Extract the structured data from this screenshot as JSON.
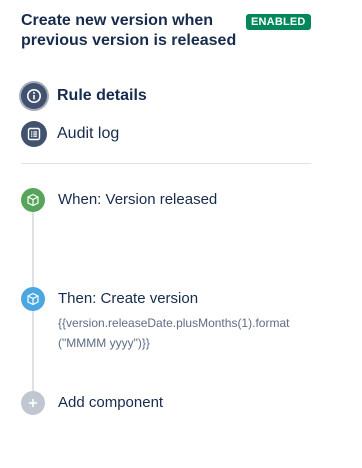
{
  "rule": {
    "title": "Create new version when previous version is released",
    "status_badge": "ENABLED"
  },
  "nav": {
    "items": [
      {
        "label": "Rule details",
        "icon": "info-icon",
        "active": true
      },
      {
        "label": "Audit log",
        "icon": "audit-log-icon",
        "active": false
      }
    ]
  },
  "components": {
    "trigger": {
      "label": "When: Version released",
      "icon": "trigger-cube-icon",
      "color": "#57a55a"
    },
    "action": {
      "label": "Then: Create version",
      "detail": "{{version.releaseDate.plusMonths(1).format(\"MMMM yyyy\")}}",
      "icon": "action-cube-icon",
      "color": "#4ba7e0"
    },
    "add": {
      "label": "Add component",
      "icon": "plus-icon"
    }
  },
  "colors": {
    "badge": "#00875a",
    "nav_icon": "#42526e",
    "timeline": "#dfe1e6"
  }
}
